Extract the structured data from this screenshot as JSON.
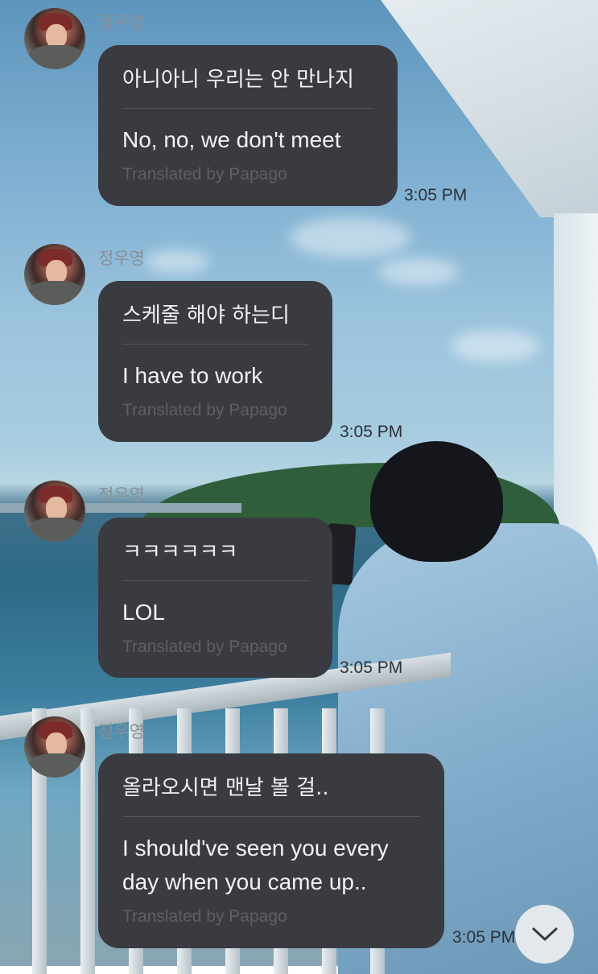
{
  "chat": {
    "messages": [
      {
        "sender": "정우영",
        "original": "아니아니 우리는 안 만나지",
        "translation": "No, no, we don't meet",
        "credit": "Translated by Papago",
        "time": "3:05 PM"
      },
      {
        "sender": "정우영",
        "original": "스케줄 해야 하는디",
        "translation": "I have to work",
        "credit": "Translated by Papago",
        "time": "3:05 PM"
      },
      {
        "sender": "정우영",
        "original": "ㅋㅋㅋㅋㅋㅋ",
        "translation": "LOL",
        "credit": "Translated by Papago",
        "time": "3:05 PM"
      },
      {
        "sender": "정우영",
        "original": "올라오시면 맨날 볼 걸..",
        "translation": "I should've seen you every day when you came up..",
        "credit": "Translated by Papago",
        "time": "3:05 PM"
      }
    ]
  },
  "controls": {
    "scroll_down_icon": "chevron-down-icon"
  },
  "colors": {
    "bubble": "#3a3b40",
    "bubble_text": "#f2f2f4",
    "credit_text": "#5d5f65",
    "name_text": "#8a8f95",
    "time_text": "#2c3136"
  }
}
